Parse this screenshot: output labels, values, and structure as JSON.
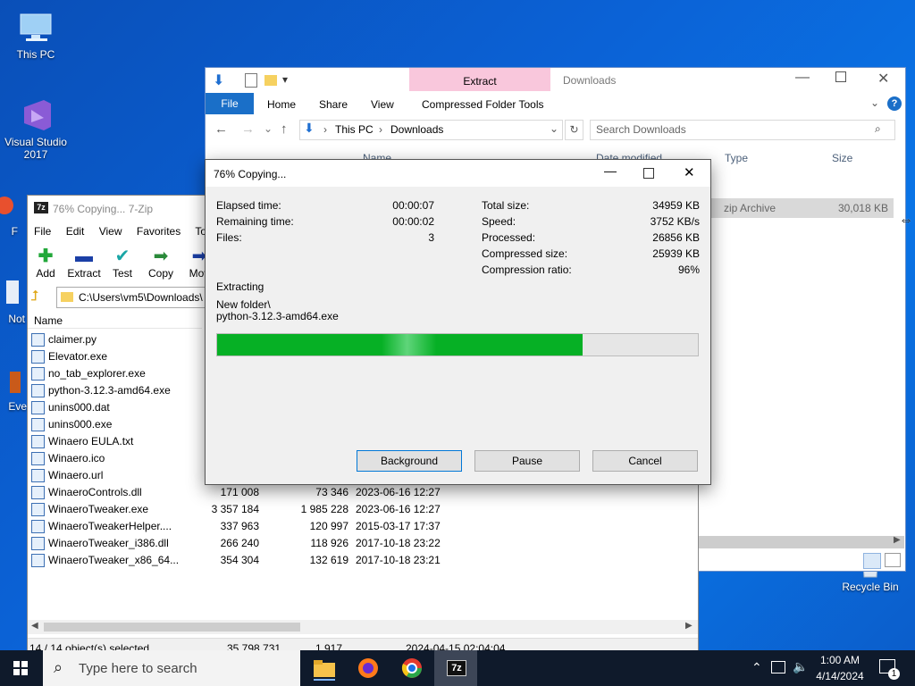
{
  "desktop": {
    "icons": [
      {
        "label": "This PC"
      },
      {
        "label": "Visual Studio 2017"
      },
      {
        "label": "Recycle Bin"
      },
      {
        "label": "F"
      },
      {
        "label": "Not"
      },
      {
        "label": "Eve"
      }
    ]
  },
  "explorer": {
    "ribbon_context_tab": "Extract",
    "ribbon_context_group": "Compressed Folder Tools",
    "window_title": "Downloads",
    "tabs": [
      "File",
      "Home",
      "Share",
      "View"
    ],
    "breadcrumb": [
      "This PC",
      "Downloads"
    ],
    "search_placeholder": "Search Downloads",
    "columns": [
      "Name",
      "Date modified",
      "Type",
      "Size"
    ],
    "row": {
      "type": "zip Archive",
      "size": "30,018 KB"
    }
  },
  "sevenzip": {
    "title": "76% Copying... 7-Zip",
    "menu": [
      "File",
      "Edit",
      "View",
      "Favorites",
      "Tools"
    ],
    "toolbar": [
      "Add",
      "Extract",
      "Test",
      "Copy",
      "Mov"
    ],
    "path": "C:\\Users\\vm5\\Downloads\\",
    "column_name": "Name",
    "files": [
      {
        "name": "claimer.py",
        "size": "",
        "packed": "",
        "modified": ""
      },
      {
        "name": "Elevator.exe",
        "size": "",
        "packed": "",
        "modified": ""
      },
      {
        "name": "no_tab_explorer.exe",
        "size": "",
        "packed": "",
        "modified": ""
      },
      {
        "name": "python-3.12.3-amd64.exe",
        "size": "",
        "packed": "",
        "modified": ""
      },
      {
        "name": "unins000.dat",
        "size": "",
        "packed": "",
        "modified": ""
      },
      {
        "name": "unins000.exe",
        "size": "",
        "packed": "",
        "modified": ""
      },
      {
        "name": "Winaero EULA.txt",
        "size": "",
        "packed": "",
        "modified": ""
      },
      {
        "name": "Winaero.ico",
        "size": "",
        "packed": "",
        "modified": ""
      },
      {
        "name": "Winaero.url",
        "size": "",
        "packed": "",
        "modified": ""
      },
      {
        "name": "WinaeroControls.dll",
        "size": "171 008",
        "packed": "73 346",
        "modified": "2023-06-16 12:27"
      },
      {
        "name": "WinaeroTweaker.exe",
        "size": "3 357 184",
        "packed": "1 985 228",
        "modified": "2023-06-16 12:27"
      },
      {
        "name": "WinaeroTweakerHelper....",
        "size": "337 963",
        "packed": "120 997",
        "modified": "2015-03-17 17:37"
      },
      {
        "name": "WinaeroTweaker_i386.dll",
        "size": "266 240",
        "packed": "118 926",
        "modified": "2017-10-18 23:22"
      },
      {
        "name": "WinaeroTweaker_x86_64...",
        "size": "354 304",
        "packed": "132 619",
        "modified": "2017-10-18 23:21"
      }
    ],
    "status": {
      "selected": "14 / 14 object(s) selected",
      "size": "35 798 731",
      "packed": "1 917",
      "date": "2024-04-15 02:04:04"
    }
  },
  "dialog": {
    "title": "76% Copying...",
    "left_stats": [
      {
        "label": "Elapsed time:",
        "value": "00:00:07"
      },
      {
        "label": "Remaining time:",
        "value": "00:00:02"
      },
      {
        "label": "Files:",
        "value": "3"
      }
    ],
    "right_stats": [
      {
        "label": "Total size:",
        "value": "34959 KB"
      },
      {
        "label": "Speed:",
        "value": "3752 KB/s"
      },
      {
        "label": "Processed:",
        "value": "26856 KB"
      },
      {
        "label": "Compressed size:",
        "value": "25939 KB"
      },
      {
        "label": "Compression ratio:",
        "value": "96%"
      }
    ],
    "operation": "Extracting",
    "current_file_line1": "New folder\\",
    "current_file_line2": "python-3.12.3-amd64.exe",
    "progress": 0.76,
    "buttons": {
      "background": "Background",
      "pause": "Pause",
      "cancel": "Cancel"
    }
  },
  "taskbar": {
    "search_placeholder": "Type here to search",
    "time": "1:00 AM",
    "date": "4/14/2024",
    "notification_count": "1"
  }
}
